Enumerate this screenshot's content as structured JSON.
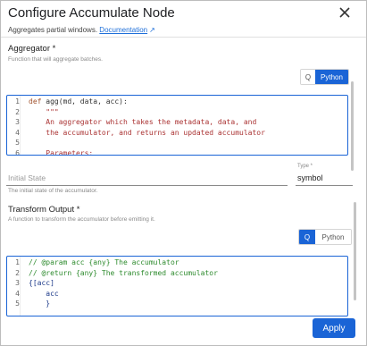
{
  "dialog": {
    "title": "Configure Accumulate Node",
    "subtitle": "Aggregates partial windows.",
    "doc_link": "Documentation",
    "apply_label": "Apply"
  },
  "aggregator": {
    "label": "Aggregator *",
    "description": "Function that will aggregate batches.",
    "toggle_q": "Q",
    "toggle_python": "Python",
    "active": "python",
    "lines": [
      {
        "n": "1",
        "text": "def agg(md, data, acc):"
      },
      {
        "n": "2",
        "text": "    \"\"\""
      },
      {
        "n": "3",
        "text": "    An aggregator which takes the metadata, data, and"
      },
      {
        "n": "4",
        "text": "    the accumulator, and returns an updated accumulator"
      },
      {
        "n": "5",
        "text": ""
      },
      {
        "n": "6",
        "text": "    Parameters:"
      }
    ]
  },
  "initial_state": {
    "label": "Initial State",
    "description": "The initial state of the accumulator.",
    "type_label": "Type *",
    "type_value": "symbol"
  },
  "transform": {
    "label": "Transform Output *",
    "description": "A function to transform the accumulator before emitting it.",
    "toggle_q": "Q",
    "toggle_python": "Python",
    "active": "q",
    "lines": [
      {
        "n": "1",
        "text": "// @param acc {any} The accumulator"
      },
      {
        "n": "2",
        "text": "// @return {any} The transformed accumulator"
      },
      {
        "n": "3",
        "text": "{[acc]"
      },
      {
        "n": "4",
        "text": "    acc"
      },
      {
        "n": "5",
        "text": "    }"
      }
    ]
  },
  "colors": {
    "accent": "#1a64d6",
    "comment": "#2e8b2e",
    "keyword": "#a0522d"
  }
}
